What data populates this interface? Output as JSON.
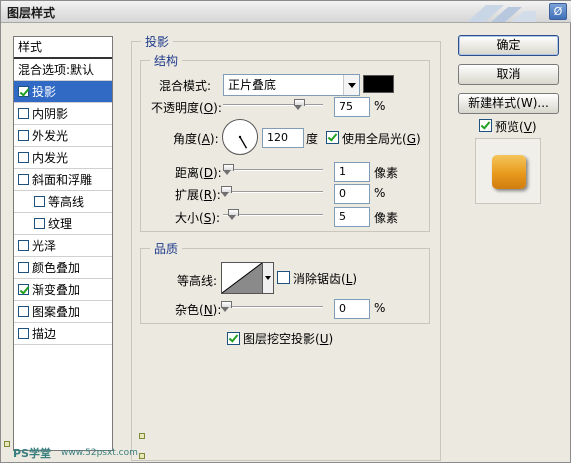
{
  "window": {
    "title": "图层样式",
    "close_label": "Ø"
  },
  "styles_list": {
    "header": "样式",
    "items": [
      {
        "label": "混合选项:默认",
        "has_checkbox": false,
        "checked": false,
        "selected": false,
        "indent": false
      },
      {
        "label": "投影",
        "has_checkbox": true,
        "checked": true,
        "selected": true,
        "indent": false
      },
      {
        "label": "内阴影",
        "has_checkbox": true,
        "checked": false,
        "selected": false,
        "indent": false
      },
      {
        "label": "外发光",
        "has_checkbox": true,
        "checked": false,
        "selected": false,
        "indent": false
      },
      {
        "label": "内发光",
        "has_checkbox": true,
        "checked": false,
        "selected": false,
        "indent": false
      },
      {
        "label": "斜面和浮雕",
        "has_checkbox": true,
        "checked": false,
        "selected": false,
        "indent": false
      },
      {
        "label": "等高线",
        "has_checkbox": true,
        "checked": false,
        "selected": false,
        "indent": true
      },
      {
        "label": "纹理",
        "has_checkbox": true,
        "checked": false,
        "selected": false,
        "indent": true
      },
      {
        "label": "光泽",
        "has_checkbox": true,
        "checked": false,
        "selected": false,
        "indent": false
      },
      {
        "label": "颜色叠加",
        "has_checkbox": true,
        "checked": false,
        "selected": false,
        "indent": false
      },
      {
        "label": "渐变叠加",
        "has_checkbox": true,
        "checked": true,
        "selected": false,
        "indent": false
      },
      {
        "label": "图案叠加",
        "has_checkbox": true,
        "checked": false,
        "selected": false,
        "indent": false
      },
      {
        "label": "描边",
        "has_checkbox": true,
        "checked": false,
        "selected": false,
        "indent": false
      }
    ]
  },
  "panel": {
    "title": "投影",
    "structure": {
      "legend": "结构",
      "blend_mode_label": "混合模式:",
      "blend_mode_value": "正片叠底",
      "shadow_color": "#000000",
      "opacity_label_pre": "不透明度(",
      "opacity_key": "O",
      "opacity_label_post": "):",
      "opacity_value": "75",
      "opacity_unit": "%",
      "opacity_level": 0.75,
      "angle_label_pre": "角度(",
      "angle_key": "A",
      "angle_label_post": "):",
      "angle_value": "120",
      "angle_deg": 120,
      "angle_unit": "度",
      "global_light_label_pre": "使用全局光(",
      "global_light_key": "G",
      "global_light_label_post": ")",
      "global_light_checked": true,
      "distance_label_pre": "距离(",
      "distance_key": "D",
      "distance_label_post": "):",
      "distance_value": "1",
      "distance_unit": "像素",
      "spread_label_pre": "扩展(",
      "spread_key": "R",
      "spread_label_post": "):",
      "spread_value": "0",
      "spread_unit": "%",
      "size_label_pre": "大小(",
      "size_key": "S",
      "size_label_post": "):",
      "size_value": "5",
      "size_unit": "像素"
    },
    "quality": {
      "legend": "品质",
      "contour_label": "等高线:",
      "antialias_label_pre": "消除锯齿(",
      "antialias_key": "L",
      "antialias_label_post": ")",
      "antialias_checked": false,
      "noise_label_pre": "杂色(",
      "noise_key": "N",
      "noise_label_post": "):",
      "noise_value": "0",
      "noise_unit": "%"
    },
    "knockout_label_pre": "图层挖空投影(",
    "knockout_key": "U",
    "knockout_label_post": ")",
    "knockout_checked": true
  },
  "buttons": {
    "ok": "确定",
    "cancel": "取消",
    "new_style": "新建样式(W)...",
    "preview_label_pre": "预览(",
    "preview_key": "V",
    "preview_label_post": ")",
    "preview_checked": true
  },
  "watermark": {
    "left": "PS学堂",
    "middle": "www.52psxt.com"
  }
}
